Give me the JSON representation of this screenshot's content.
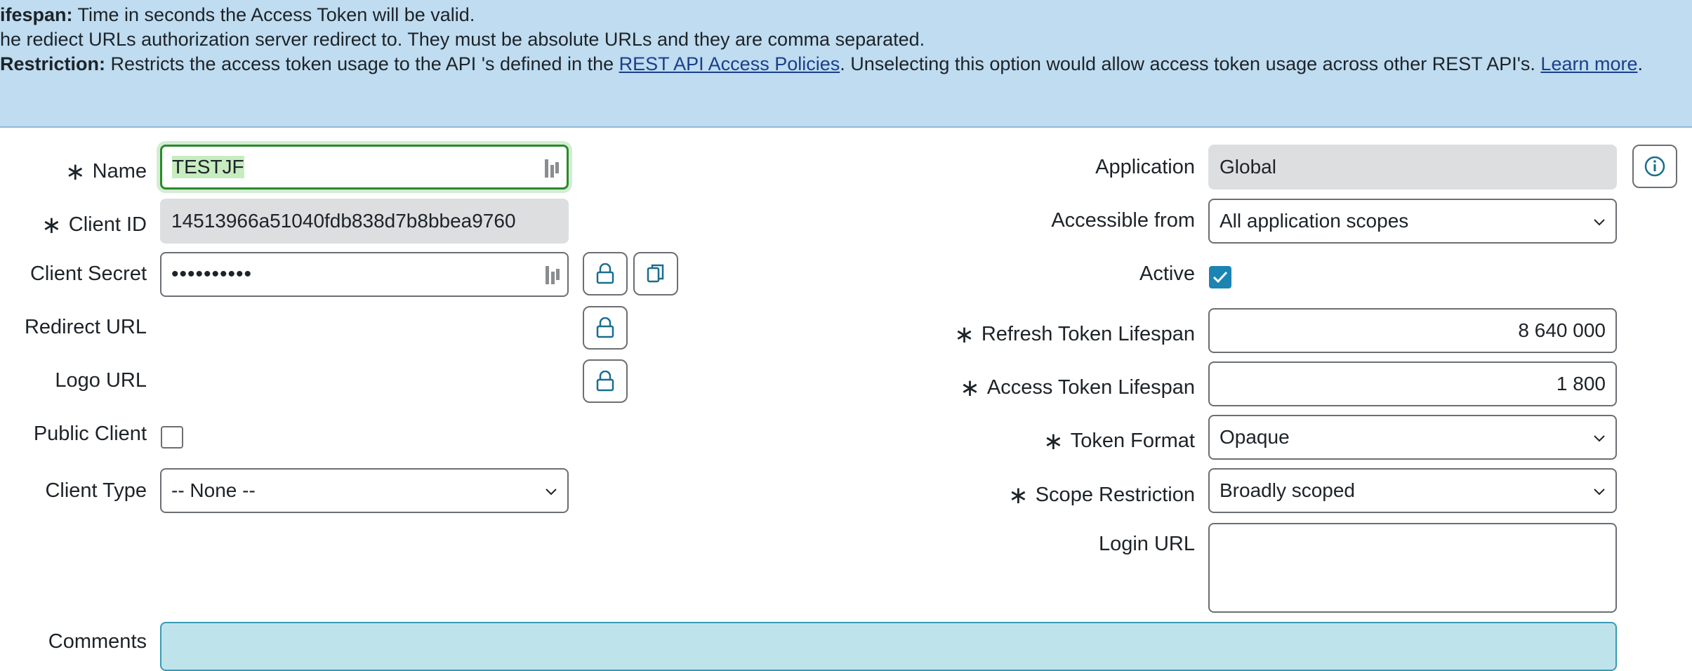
{
  "banner": {
    "line1_bold": "ifespan:",
    "line1_text": " Time in seconds the Access Token will be valid.",
    "line2_text": "he rediect URLs authorization server redirect to. They must be absolute URLs and they are comma separated.",
    "line3_bold": "Restriction:",
    "line3_text_a": " Restricts the access token usage to the API 's defined in the ",
    "line3_link1": "REST API Access Policies",
    "line3_text_b": ". Unselecting this option would allow access token usage across other REST API's. ",
    "line3_link2": "Learn more",
    "line3_text_c": "."
  },
  "form": {
    "left": {
      "name_label": "Name",
      "name_value": "TESTJF",
      "client_id_label": "Client ID",
      "client_id_value": "14513966a51040fdb838d7b8bbea9760",
      "client_secret_label": "Client Secret",
      "client_secret_value": "••••••••••",
      "redirect_url_label": "Redirect URL",
      "logo_url_label": "Logo URL",
      "public_client_label": "Public Client",
      "client_type_label": "Client Type",
      "client_type_value": "-- None --"
    },
    "right": {
      "application_label": "Application",
      "application_value": "Global",
      "accessible_from_label": "Accessible from",
      "accessible_from_value": "All application scopes",
      "active_label": "Active",
      "refresh_token_label": "Refresh Token Lifespan",
      "refresh_token_value": "8 640 000",
      "access_token_label": "Access Token Lifespan",
      "access_token_value": "1 800",
      "token_format_label": "Token Format",
      "token_format_value": "Opaque",
      "scope_restriction_label": "Scope Restriction",
      "scope_restriction_value": "Broadly scoped",
      "login_url_label": "Login URL"
    },
    "comments_label": "Comments",
    "required_marker": "∗"
  },
  "colors": {
    "banner_bg": "#bfdcf0",
    "focus_border": "#2a8a2a",
    "checkbox_on": "#1b84b3",
    "accent": "#1a6e8e"
  },
  "states": {
    "active_checked": true,
    "public_client_checked": false
  }
}
